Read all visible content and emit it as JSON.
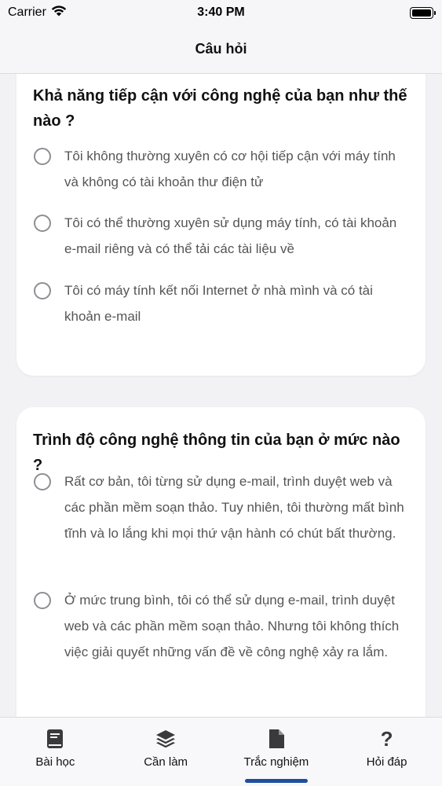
{
  "status_bar": {
    "carrier": "Carrier",
    "time": "3:40 PM"
  },
  "nav": {
    "title": "Câu hỏi"
  },
  "questions": [
    {
      "text": "Khả năng tiếp cận với công nghệ của bạn như thế nào ?",
      "options": [
        "Tôi không thường xuyên có cơ hội tiếp cận với máy tính và không có tài khoản thư điện tử",
        "Tôi có thể thường xuyên sử dụng máy tính, có tài khoản e-mail riêng và có thể tải các tài liệu về",
        "Tôi có máy tính kết nối Internet ở nhà mình và có tài khoản e-mail"
      ]
    },
    {
      "text": "Trình độ công nghệ thông tin của bạn ở mức nào ?",
      "options": [
        "Rất cơ bản, tôi từng sử dụng e-mail, trình duyệt web và các phần mềm soạn thảo. Tuy nhiên, tôi thường mất bình tĩnh và lo lắng khi mọi thứ vận hành có chút bất thường.",
        "Ở mức trung bình, tôi có thể sử dụng e-mail, trình duyệt web và các phần mềm soạn thảo. Nhưng tôi không thích việc giải quyết những vấn đề về công nghệ xảy ra lắm."
      ]
    }
  ],
  "tabs": [
    {
      "label": "Bài học",
      "icon": "book-icon"
    },
    {
      "label": "Cần làm",
      "icon": "layers-icon"
    },
    {
      "label": "Trắc nghiệm",
      "icon": "document-icon",
      "selected": true
    },
    {
      "label": "Hỏi đáp",
      "icon": "question-icon"
    }
  ],
  "colors": {
    "accent": "#1f4e9e",
    "background": "#f2f2f4",
    "card": "#ffffff",
    "radio_border": "#8e8e93"
  }
}
